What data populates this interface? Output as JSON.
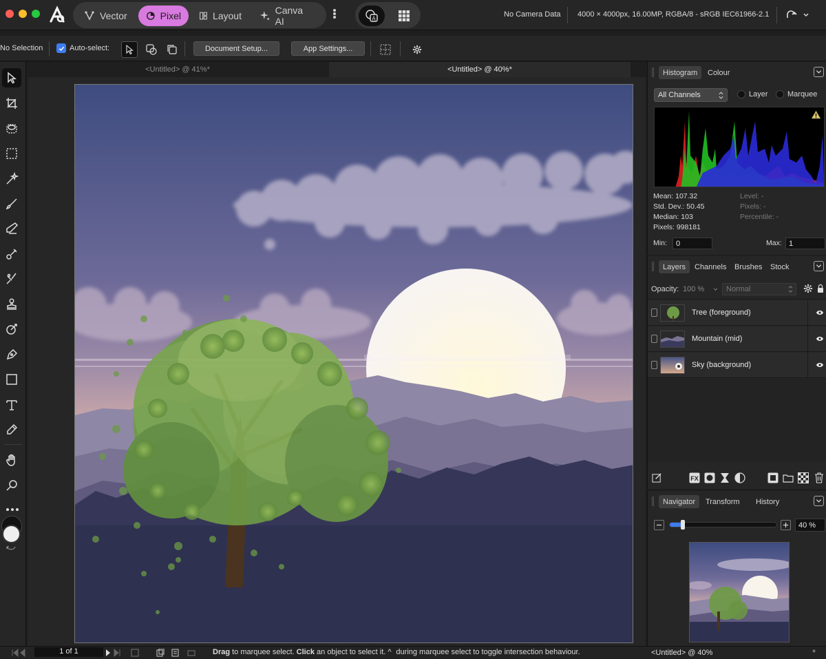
{
  "titlebar": {
    "personas": [
      {
        "label": "Vector",
        "icon": "vector-persona-icon"
      },
      {
        "label": "Pixel",
        "icon": "pixel-persona-icon",
        "active": true
      },
      {
        "label": "Layout",
        "icon": "layout-persona-icon"
      },
      {
        "label": "Canva AI",
        "icon": "sparkle-icon"
      }
    ],
    "camera_info": "No Camera Data",
    "document_info": "4000 × 4000px, 16.00MP, RGBA/8 - sRGB IEC61966-2.1"
  },
  "context": {
    "selection": "No Selection",
    "auto_select_label": "Auto-select:",
    "auto_select_checked": true,
    "document_setup": "Document Setup...",
    "app_settings": "App Settings..."
  },
  "tabs": [
    {
      "label": "<Untitled> @ 41%*",
      "active": false
    },
    {
      "label": "<Untitled> @ 40%*",
      "active": true
    }
  ],
  "histogram_panel": {
    "tabs": [
      "Histogram",
      "Colour"
    ],
    "channel": "All Channels",
    "layer_option": "Layer",
    "marquee_option": "Marquee",
    "mean": "Mean: 107.32",
    "std_dev": "Std. Dev.: 50.45",
    "median": "Median: 103",
    "pixels": "Pixels: 998181",
    "level": "Level: -",
    "pixels_sel": "Pixels: -",
    "percentile": "Percentile: -",
    "min_label": "Min:",
    "min_value": "0",
    "max_label": "Max:",
    "max_value": "1",
    "colors": {
      "red": "#e02020",
      "green": "#22c022",
      "blue": "#2a2ad8"
    }
  },
  "layers_panel": {
    "tabs": [
      "Layers",
      "Channels",
      "Brushes",
      "Stock"
    ],
    "opacity_label": "Opacity:",
    "opacity_value": "100 %",
    "blend_mode": "Normal",
    "layers": [
      {
        "name": "Tree (foreground)"
      },
      {
        "name": "Mountain (mid)"
      },
      {
        "name": "Sky (background)"
      }
    ]
  },
  "navigator_panel": {
    "tabs": [
      "Navigator",
      "Transform",
      "History"
    ],
    "zoom_value": "40 %",
    "zoom_fraction": 0.12
  },
  "statusbar": {
    "page": "1 of 1",
    "hint_drag": "Drag",
    "hint_1": " to marquee select. ",
    "hint_click": "Click",
    "hint_2": " an object to select it. ",
    "hint_3": " during marquee select to toggle intersection behaviour.",
    "doc_label": "<Untitled> @ 40%"
  }
}
